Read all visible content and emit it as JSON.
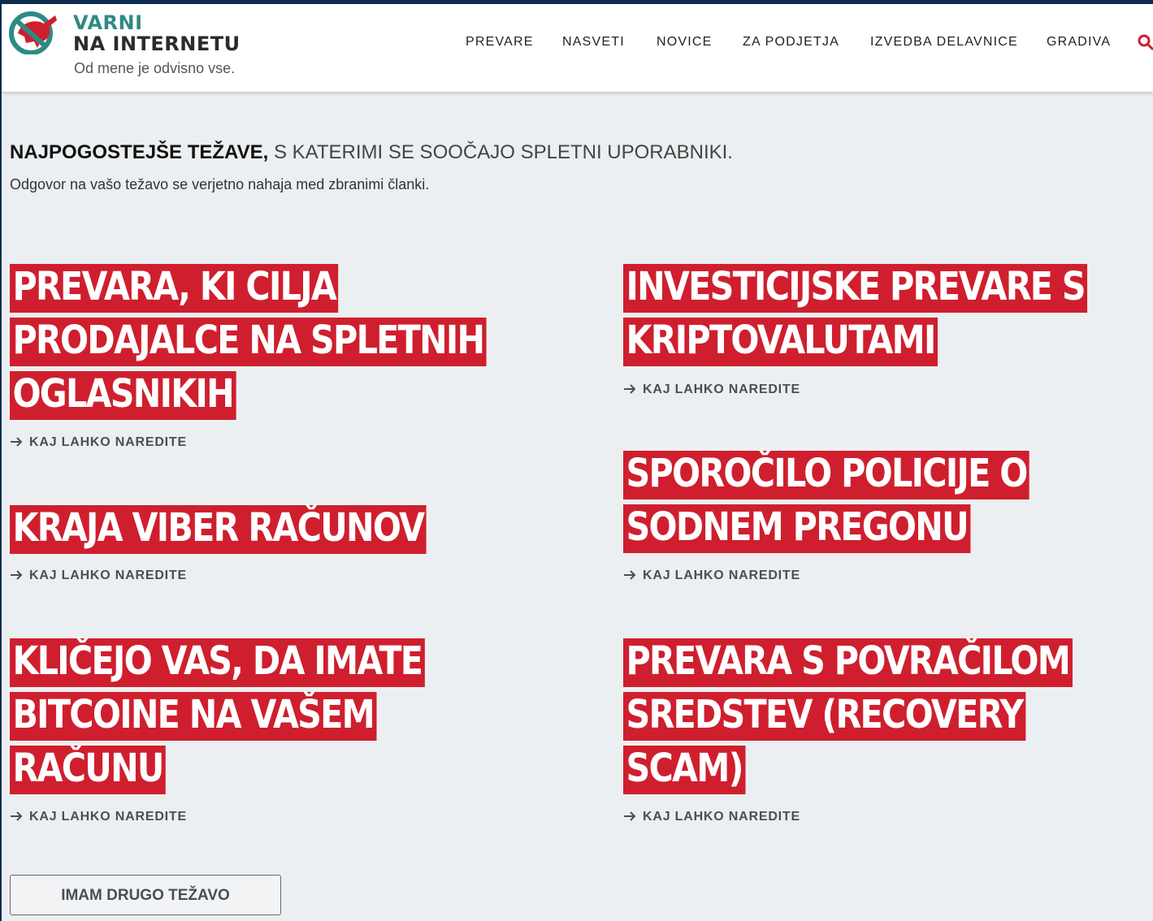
{
  "header": {
    "logo": {
      "line1": "VARNI",
      "line2": "NA INTERNETU",
      "tagline": "Od mene je odvisno vse."
    },
    "nav": [
      {
        "label": "PREVARE"
      },
      {
        "label": "NASVETI"
      },
      {
        "label": "NOVICE"
      },
      {
        "label": "ZA PODJETJA"
      },
      {
        "label": "IZVEDBA DELAVNICE"
      },
      {
        "label": "GRADIVA"
      }
    ],
    "search_icon": "search-icon"
  },
  "intro": {
    "title_bold": "NAJPOGOSTEJŠE TEŽAVE,",
    "title_light": " S KATERIMI SE SOOČAJO SPLETNI UPORABNIKI.",
    "subtitle": "Odgovor na vašo težavo se verjetno nahaja med zbranimi članki."
  },
  "cards": [
    {
      "lines": [
        "PREVARA, KI CILJA",
        "PRODAJALCE NA SPLETNIH",
        "OGLASNIKIH"
      ],
      "link": "KAJ LAHKO NAREDITE"
    },
    {
      "lines": [
        "INVESTICIJSKE PREVARE S",
        "KRIPTOVALUTAMI"
      ],
      "link": "KAJ LAHKO NAREDITE"
    },
    {
      "lines": [
        "KRAJA VIBER RAČUNOV"
      ],
      "link": "KAJ LAHKO NAREDITE"
    },
    {
      "lines": [
        "SPOROČILO POLICIJE O",
        "SODNEM PREGONU"
      ],
      "link": "KAJ LAHKO NAREDITE"
    },
    {
      "lines": [
        "KLIČEJO VAS, DA IMATE",
        "BITCOINE NA VAŠEM",
        "RAČUNU"
      ],
      "link": "KAJ LAHKO NAREDITE"
    },
    {
      "lines": [
        "PREVARA S POVRAČILOM",
        "SREDSTEV (RECOVERY",
        "SCAM)"
      ],
      "link": "KAJ LAHKO NAREDITE"
    }
  ],
  "other_button": {
    "label": "IMAM DRUGO TEŽAVO"
  },
  "colors": {
    "accent_red": "#cf1f2e",
    "logo_teal": "#2e8a85",
    "page_bg": "#eceff1",
    "outer_frame": "#0e2a4d"
  }
}
